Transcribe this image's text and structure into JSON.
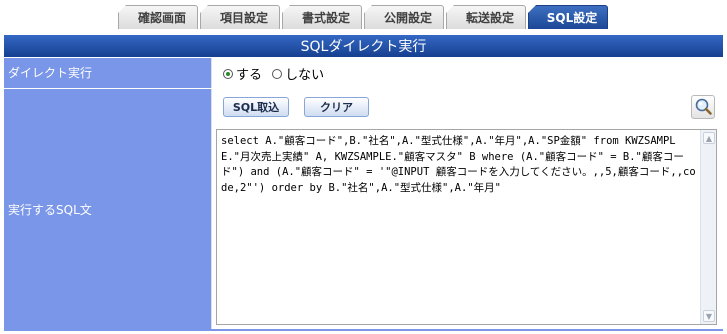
{
  "tabs": [
    {
      "label": "確認画面",
      "active": false
    },
    {
      "label": "項目設定",
      "active": false
    },
    {
      "label": "書式設定",
      "active": false
    },
    {
      "label": "公開設定",
      "active": false
    },
    {
      "label": "転送設定",
      "active": false
    },
    {
      "label": "SQL設定",
      "active": true
    }
  ],
  "section_title": "SQLダイレクト実行",
  "direct_exec": {
    "label": "ダイレクト実行",
    "options": [
      {
        "label": "する",
        "selected": true
      },
      {
        "label": "しない",
        "selected": false
      }
    ]
  },
  "sql": {
    "label": "実行するSQL文",
    "fetch_button": "SQL取込",
    "clear_button": "クリア",
    "search_icon": "magnifier-icon",
    "text": "select A.\"顧客コード\",B.\"社名\",A.\"型式仕様\",A.\"年月\",A.\"SP金額\" from KWZSAMPLE.\"月次売上実績\" A, KWZSAMPLE.\"顧客マスタ\" B where (A.\"顧客コード\" = B.\"顧客コード\") and (A.\"顧客コード\" = '\"@INPUT 顧客コードを入力してください。,,5,顧客コード,,code,2\"') order by B.\"社名\",A.\"型式仕様\",A.\"年月\""
  },
  "colors": {
    "header_blue": "#1c4796",
    "label_bg": "#7996e8",
    "radio_selected": "#2b8a2b"
  }
}
